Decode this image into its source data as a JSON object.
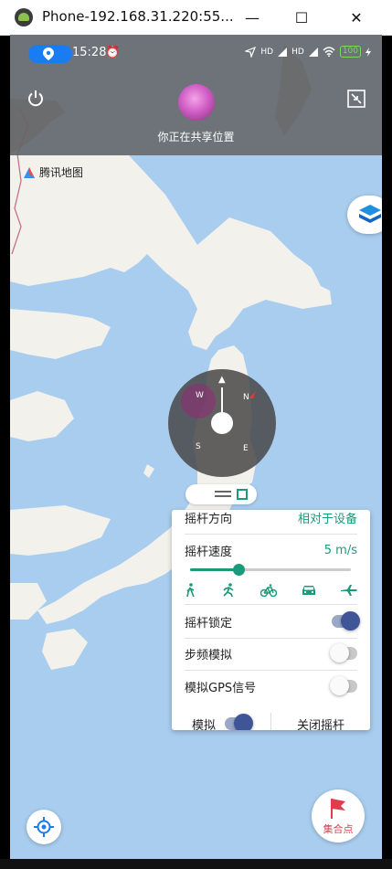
{
  "window": {
    "title": "Phone-192.168.31.220:55...",
    "minimize": "—",
    "maximize": "☐",
    "close": "✕"
  },
  "status_bar": {
    "time": "15:28",
    "alarm_icon": "⏰",
    "signal_labels": [
      "HD",
      "HD"
    ],
    "battery": "100"
  },
  "header": {
    "share_text": "你正在共享位置"
  },
  "map": {
    "logo_text": "腾讯地图"
  },
  "joystick": {
    "labels": [
      "N",
      "W",
      "S",
      "E"
    ]
  },
  "panel": {
    "direction_label": "摇杆方向",
    "direction_value": "相对于设备",
    "speed_label": "摇杆速度",
    "speed_value": "5 m/s",
    "speed_level": 0.3,
    "speed_modes": [
      "walk",
      "run",
      "bike",
      "car",
      "plane"
    ],
    "lock_label": "摇杆锁定",
    "lock_on": true,
    "step_label": "步频模拟",
    "step_on": false,
    "gps_label": "模拟GPS信号",
    "gps_on": false,
    "simulate_label": "模拟",
    "simulate_on": true,
    "close_label": "关闭摇杆"
  },
  "buttons": {
    "gather_label": "集合点"
  },
  "colors": {
    "accent": "#1a9a78",
    "toggle_on": "#3f5597",
    "gather": "#e33b4e",
    "sea": "#a9cdee",
    "land": "#f3f1ec"
  }
}
